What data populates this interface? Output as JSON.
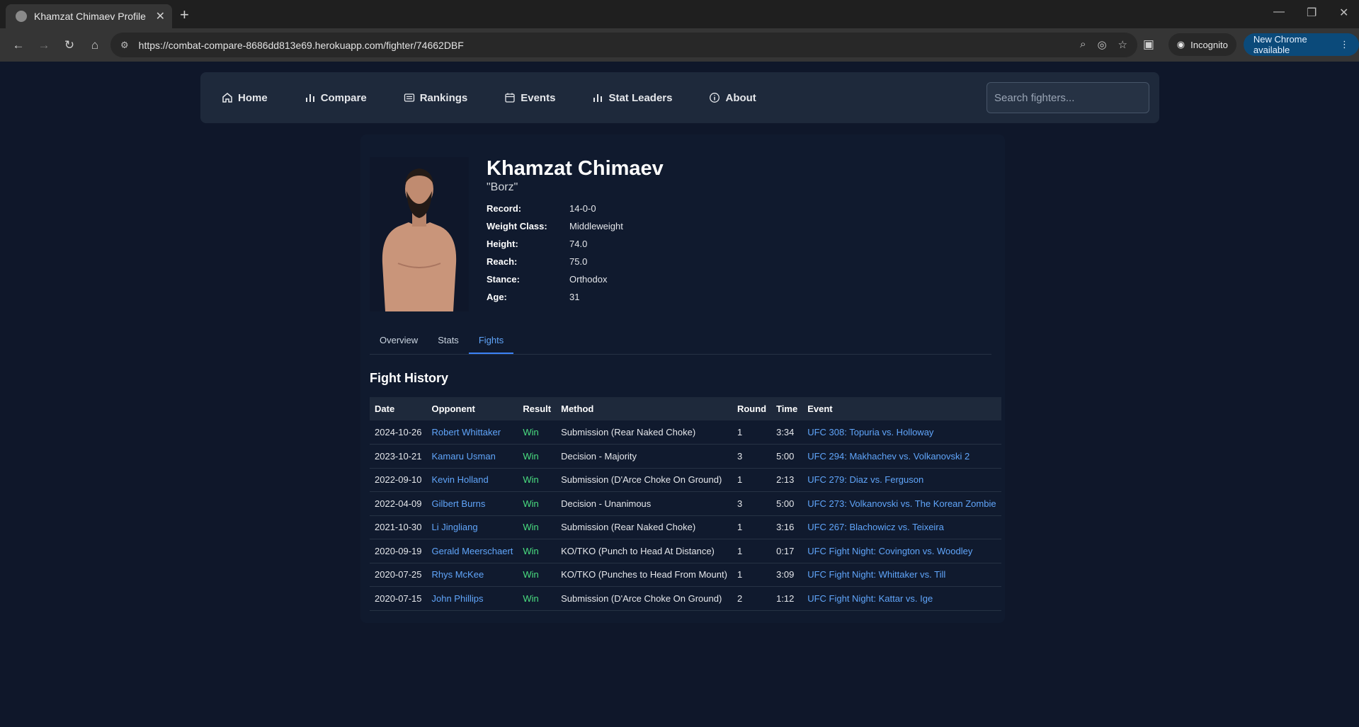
{
  "browser": {
    "tab_title": "Khamzat Chimaev Profile",
    "url": "https://combat-compare-8686dd813e69.herokuapp.com/fighter/74662DBF",
    "incognito_label": "Incognito",
    "update_label": "New Chrome available"
  },
  "nav": {
    "items": [
      {
        "label": "Home",
        "icon": "home-icon"
      },
      {
        "label": "Compare",
        "icon": "bar-chart-icon"
      },
      {
        "label": "Rankings",
        "icon": "list-icon"
      },
      {
        "label": "Events",
        "icon": "calendar-icon"
      },
      {
        "label": "Stat Leaders",
        "icon": "bar-chart-icon"
      },
      {
        "label": "About",
        "icon": "info-icon"
      }
    ],
    "search_placeholder": "Search fighters..."
  },
  "fighter": {
    "name": "Khamzat Chimaev",
    "nickname": "\"Borz\"",
    "details": [
      {
        "label": "Record:",
        "value": "14-0-0"
      },
      {
        "label": "Weight Class:",
        "value": "Middleweight"
      },
      {
        "label": "Height:",
        "value": "74.0"
      },
      {
        "label": "Reach:",
        "value": "75.0"
      },
      {
        "label": "Stance:",
        "value": "Orthodox"
      },
      {
        "label": "Age:",
        "value": "31"
      }
    ]
  },
  "tabs": [
    {
      "label": "Overview",
      "active": false
    },
    {
      "label": "Stats",
      "active": false
    },
    {
      "label": "Fights",
      "active": true
    }
  ],
  "fight_history": {
    "title": "Fight History",
    "columns": [
      "Date",
      "Opponent",
      "Result",
      "Method",
      "Round",
      "Time",
      "Event"
    ],
    "rows": [
      [
        "2024-10-26",
        "Robert Whittaker",
        "Win",
        "Submission (Rear Naked Choke)",
        "1",
        "3:34",
        "UFC 308: Topuria vs. Holloway"
      ],
      [
        "2023-10-21",
        "Kamaru Usman",
        "Win",
        "Decision - Majority",
        "3",
        "5:00",
        "UFC 294: Makhachev vs. Volkanovski 2"
      ],
      [
        "2022-09-10",
        "Kevin Holland",
        "Win",
        "Submission (D'Arce Choke On Ground)",
        "1",
        "2:13",
        "UFC 279: Diaz vs. Ferguson"
      ],
      [
        "2022-04-09",
        "Gilbert Burns",
        "Win",
        "Decision - Unanimous",
        "3",
        "5:00",
        "UFC 273: Volkanovski vs. The Korean Zombie"
      ],
      [
        "2021-10-30",
        "Li Jingliang",
        "Win",
        "Submission (Rear Naked Choke)",
        "1",
        "3:16",
        "UFC 267: Blachowicz vs. Teixeira"
      ],
      [
        "2020-09-19",
        "Gerald Meerschaert",
        "Win",
        "KO/TKO (Punch to Head At Distance)",
        "1",
        "0:17",
        "UFC Fight Night: Covington vs. Woodley"
      ],
      [
        "2020-07-25",
        "Rhys McKee",
        "Win",
        "KO/TKO (Punches to Head From Mount)",
        "1",
        "3:09",
        "UFC Fight Night: Whittaker vs. Till"
      ],
      [
        "2020-07-15",
        "John Phillips",
        "Win",
        "Submission (D'Arce Choke On Ground)",
        "2",
        "1:12",
        "UFC Fight Night: Kattar vs. Ige"
      ]
    ]
  },
  "colors": {
    "background": "#0f172a",
    "link": "#60a5fa",
    "win": "#4ade80"
  }
}
